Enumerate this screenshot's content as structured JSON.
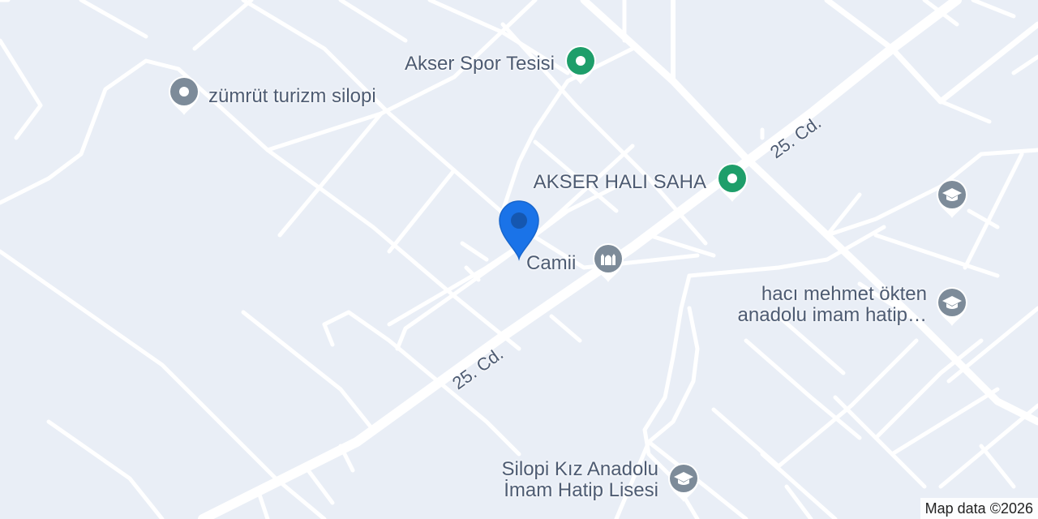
{
  "places": {
    "akser_spor": "Akser Spor Tesisi",
    "zumrut": "zümrüt turizm silopi",
    "akser_hali": "AKSER HALI SAHA",
    "camii": "Camii",
    "haci_line1": "hacı mehmet ökten",
    "haci_line2": "anadolu imam hatip…",
    "silopi_line1": "Silopi Kız Anadolu",
    "silopi_line2": "İmam Hatip Lisesi"
  },
  "roads": {
    "road_upper": "25. Cd.",
    "road_lower": "25. Cd."
  },
  "icons": {
    "sports": "sports-pin-icon",
    "poi": "poi-pin-icon",
    "mosque": "mosque-pin-icon",
    "school": "school-pin-icon",
    "location": "location-marker-icon"
  },
  "colors": {
    "background": "#e9eef6",
    "road": "#ffffff",
    "label": "#4d5b72",
    "sports_pin": "#1e9e6a",
    "gray_pin": "#7d8b99",
    "location_marker": "#1a73e8"
  },
  "attribution": "Map data ©2026"
}
